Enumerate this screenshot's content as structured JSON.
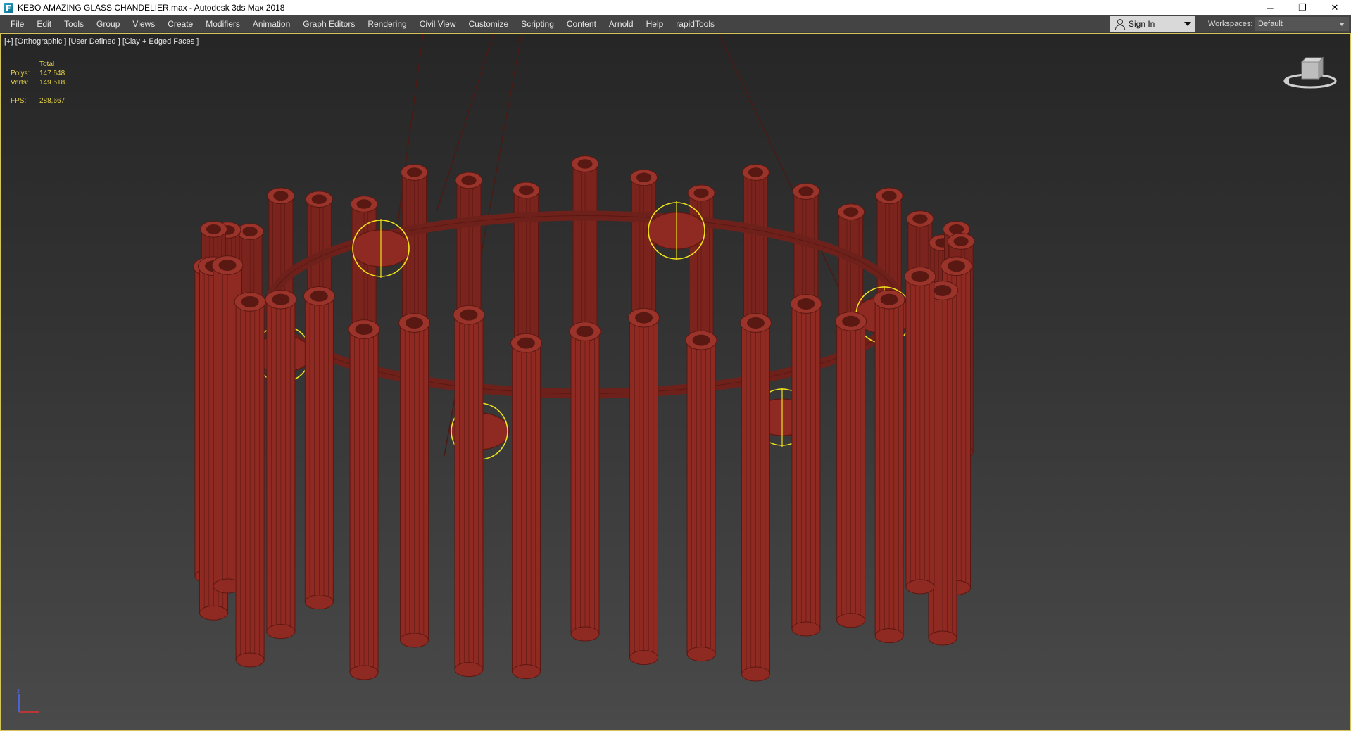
{
  "window": {
    "title": "KEBO AMAZING GLASS CHANDELIER.max - Autodesk 3ds Max 2018",
    "minimize": "─",
    "restore": "❐",
    "close": "✕"
  },
  "menu": {
    "items": [
      "File",
      "Edit",
      "Tools",
      "Group",
      "Views",
      "Create",
      "Modifiers",
      "Animation",
      "Graph Editors",
      "Rendering",
      "Civil View",
      "Customize",
      "Scripting",
      "Content",
      "Arnold",
      "Help",
      "rapidTools"
    ],
    "sign_in": "Sign In",
    "workspaces_label": "Workspaces:",
    "workspace_value": "Default"
  },
  "viewport": {
    "label": "[+] [Orthographic ] [User Defined ] [Clay + Edged Faces ]",
    "stats": {
      "header": "Total",
      "polys_label": "Polys:",
      "polys_value": "147 648",
      "verts_label": "Verts:",
      "verts_value": "149 518",
      "fps_label": "FPS:",
      "fps_value": "288,667"
    },
    "axis_label": "z"
  },
  "colors": {
    "model": "#8e2a22",
    "wire": "#5c1712",
    "lights": "#f2e21a",
    "stats_text": "#e6d347"
  }
}
